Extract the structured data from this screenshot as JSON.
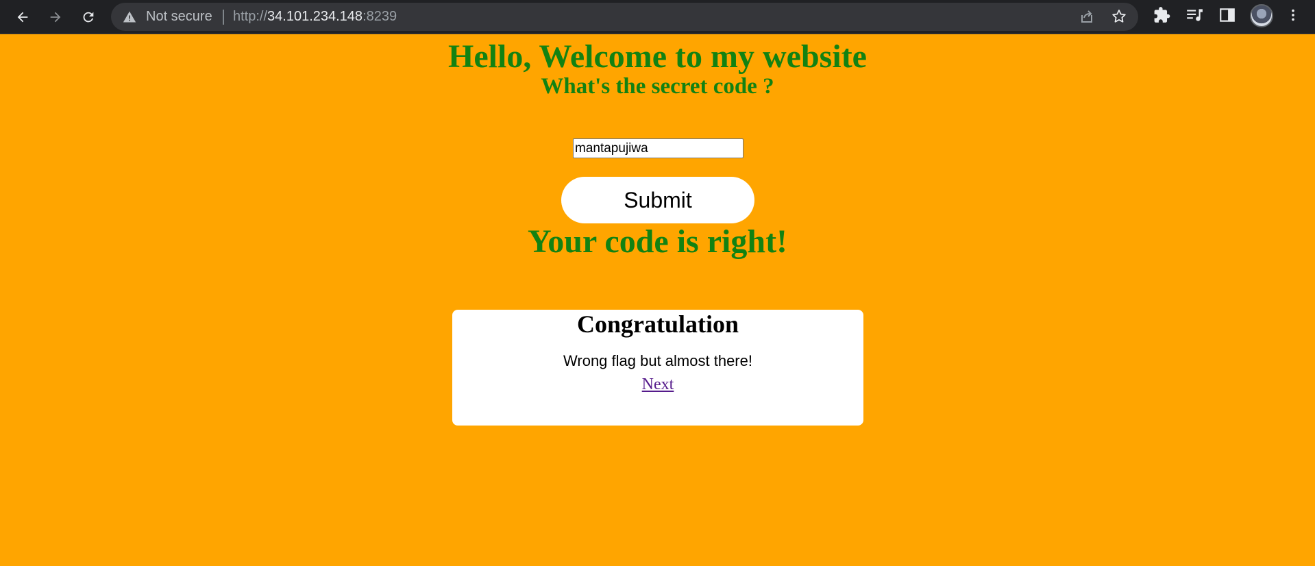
{
  "browser": {
    "security_label": "Not secure",
    "url_scheme": "http://",
    "url_host": "34.101.234.148",
    "url_port": ":8239",
    "icons": [
      "back-icon",
      "forward-icon",
      "reload-icon",
      "warning-icon",
      "share-icon",
      "bookmark-star-icon",
      "extensions-icon",
      "media-queue-icon",
      "side-panel-icon",
      "avatar",
      "menu-icon"
    ]
  },
  "page": {
    "background_color": "#ffa500",
    "accent_color": "#128212",
    "heading": "Hello, Welcome to my website",
    "subheading": "What's the secret code ?",
    "input_value": "mantapujiwa",
    "submit_label": "Submit",
    "result_text": "Your code is right!",
    "card": {
      "title": "Congratulation",
      "message": "Wrong flag but almost there!",
      "link_label": "Next"
    }
  }
}
